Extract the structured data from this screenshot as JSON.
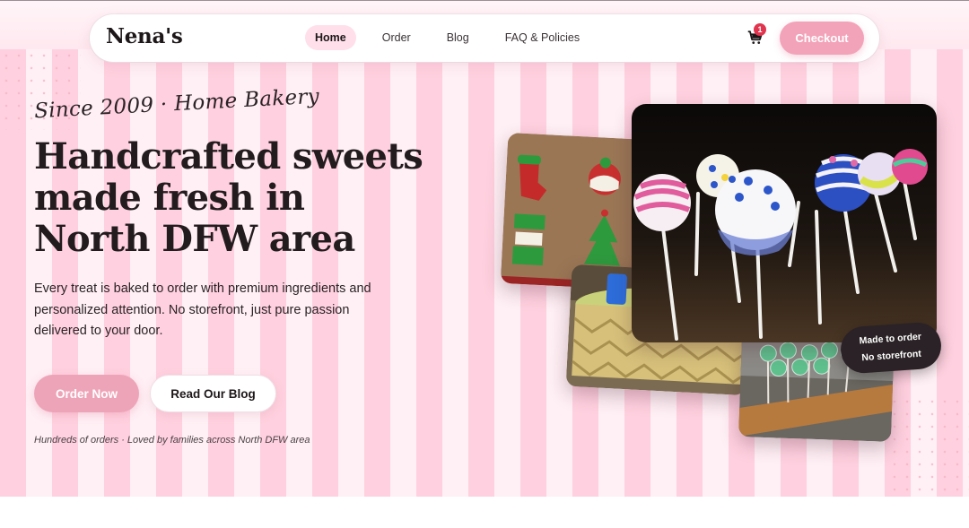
{
  "brand": {
    "name": "Nena's"
  },
  "nav": {
    "items": [
      {
        "label": "Home",
        "active": true
      },
      {
        "label": "Order",
        "active": false
      },
      {
        "label": "Blog",
        "active": false
      },
      {
        "label": "FAQ & Policies",
        "active": false
      }
    ],
    "cart": {
      "icon": "cart-icon",
      "count": "1"
    },
    "checkout_label": "Checkout"
  },
  "hero": {
    "script_line": "Since 2009 · Home Bakery",
    "headline": "Handcrafted sweets made fresh in North DFW area",
    "description": "Every treat is baked to order with premium ingredients and personalized attention. No storefront, just pure passion delivered to your door.",
    "primary_cta": "Order Now",
    "secondary_cta": "Read Our Blog",
    "social_proof": "Hundreds of orders · Loved by families across North DFW area"
  },
  "badge": {
    "line1": "Made to order",
    "line2": "No storefront"
  },
  "colors": {
    "accent": "#f3a3b9",
    "stripe_pink": "#ffd0df",
    "stripe_light": "#fff0f5",
    "dark": "#231c1f",
    "badge_red": "#e0344f"
  }
}
